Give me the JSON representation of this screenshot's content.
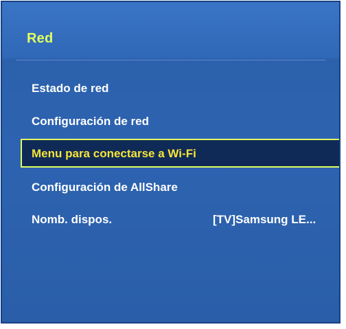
{
  "panel": {
    "title": "Red"
  },
  "menu": {
    "items": [
      {
        "label": "Estado de red",
        "value": ""
      },
      {
        "label": "Configuración de red",
        "value": ""
      },
      {
        "label": "Menu para conectarse a Wi-Fi",
        "value": ""
      },
      {
        "label": "Configuración de AllShare",
        "value": ""
      },
      {
        "label": "Nomb. dispos.",
        "value": "[TV]Samsung LE..."
      }
    ],
    "selected_index": 2
  },
  "colors": {
    "panel_background": "#2d63b0",
    "panel_border": "#174183",
    "title_color": "#e2ff5f",
    "selected_background": "#0f2a56",
    "selected_border": "#e2ff5f",
    "selected_text": "#f6e43a",
    "item_text": "#ffffff"
  }
}
